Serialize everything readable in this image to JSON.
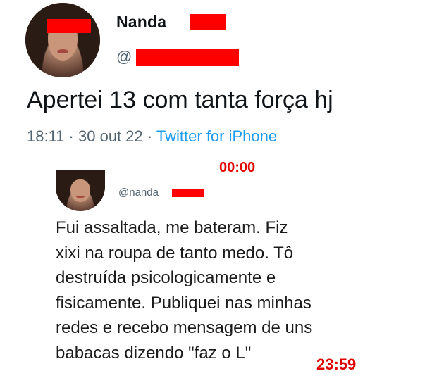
{
  "tweet": {
    "name": "Nanda",
    "handle": "@",
    "text": "Apertei 13 com tanta força hj",
    "time": "18:11",
    "separator": "·",
    "date": "30 out 22",
    "source": "Twitter for iPhone"
  },
  "annotations": {
    "start_time": "00:00",
    "end_time": "23:59"
  },
  "quoted_tweet": {
    "handle": "@nanda",
    "lines": [
      "Fui assaltada, me bateram. Fiz",
      "xixi na roupa de tanto medo. Tô",
      "destruída psicologicamente e",
      "fisicamente. Publiquei nas minhas",
      "redes e recebo mensagem de uns",
      "babacas dizendo \"faz o L\""
    ]
  },
  "colors": {
    "redaction": "#ff0000",
    "annotation": "#e00000",
    "link": "#1d9bf0",
    "muted": "#536471"
  },
  "icons": {
    "main_avatar": "user-avatar",
    "quoted_avatar": "user-avatar"
  }
}
